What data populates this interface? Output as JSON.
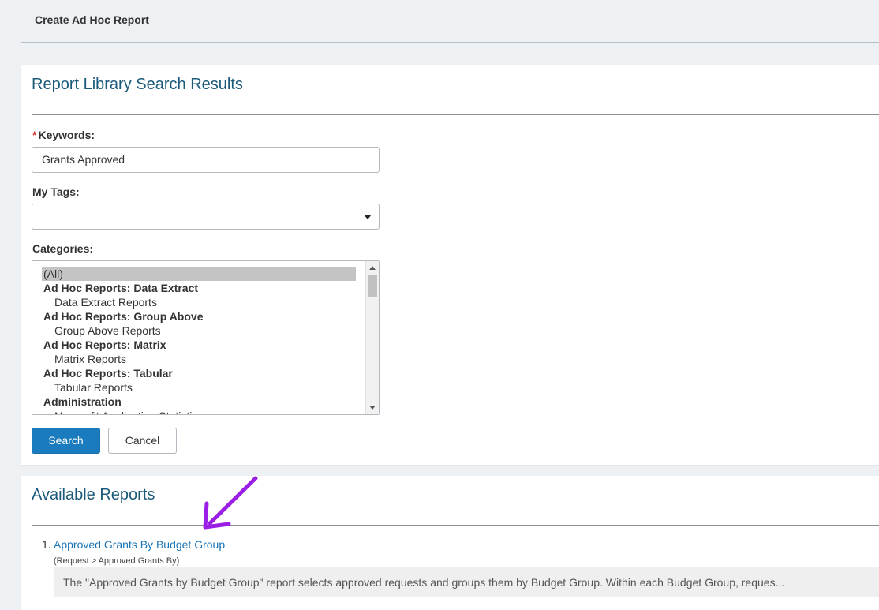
{
  "header": {
    "title": "Create Ad Hoc Report"
  },
  "search_panel": {
    "title": "Report Library Search Results",
    "keywords": {
      "required_mark": "*",
      "label": "Keywords:",
      "value": "Grants Approved"
    },
    "tags": {
      "label": "My Tags:",
      "value": ""
    },
    "categories": {
      "label": "Categories:",
      "options": [
        {
          "label": "(All)",
          "kind": "all",
          "selected": true
        },
        {
          "label": "Ad Hoc Reports: Data Extract",
          "kind": "group"
        },
        {
          "label": "Data Extract Reports",
          "kind": "item"
        },
        {
          "label": "Ad Hoc Reports: Group Above",
          "kind": "group"
        },
        {
          "label": "Group Above Reports",
          "kind": "item"
        },
        {
          "label": "Ad Hoc Reports: Matrix",
          "kind": "group"
        },
        {
          "label": "Matrix Reports",
          "kind": "item"
        },
        {
          "label": "Ad Hoc Reports: Tabular",
          "kind": "group"
        },
        {
          "label": "Tabular Reports",
          "kind": "item"
        },
        {
          "label": "Administration",
          "kind": "group"
        },
        {
          "label": "Nonprofit Application Statistics",
          "kind": "item"
        }
      ]
    },
    "buttons": {
      "search": "Search",
      "cancel": "Cancel"
    }
  },
  "results_panel": {
    "title": "Available Reports",
    "results": [
      {
        "number": "1.",
        "title": "Approved Grants By Budget Group",
        "path": "(Request > Approved Grants By)",
        "description": "The \"Approved Grants by Budget Group\" report selects approved requests and groups them by Budget Group. Within each Budget Group, reques..."
      }
    ]
  },
  "annotation": {
    "arrow_color": "#9b1ee6"
  }
}
